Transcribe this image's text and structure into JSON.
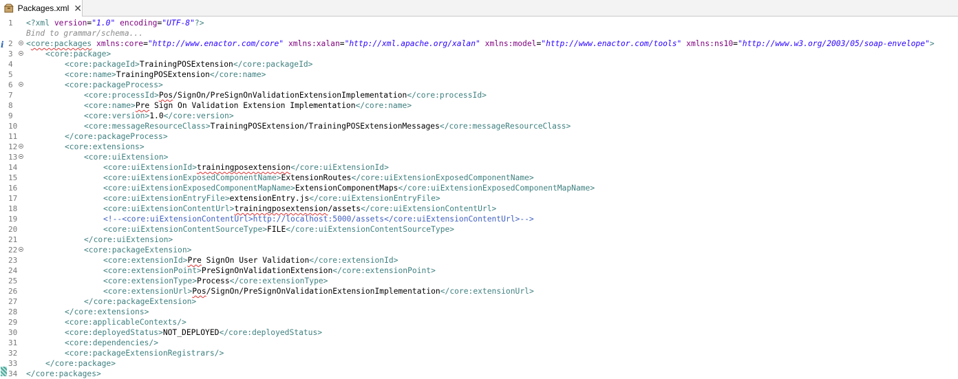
{
  "tab": {
    "title": "Packages.xml",
    "close": "✕"
  },
  "hint_text": "Bind to grammar/schema...",
  "lines": [
    {
      "n": "1",
      "fold": false,
      "indent": 0,
      "parts": [
        [
          "pi",
          "<?xml "
        ],
        [
          "attr",
          "version"
        ],
        [
          "t",
          "="
        ],
        [
          "str",
          "\"1.0\""
        ],
        [
          "t",
          " "
        ],
        [
          "attr",
          "encoding"
        ],
        [
          "t",
          "="
        ],
        [
          "str",
          "\"UTF-8\""
        ],
        [
          "pi",
          "?>"
        ]
      ]
    },
    {
      "n": "",
      "fold": false,
      "indent": 0,
      "hint": true,
      "parts": [
        [
          "hint",
          "Bind to grammar/schema..."
        ]
      ]
    },
    {
      "n": "2",
      "fold": true,
      "indent": 0,
      "parts": [
        [
          "tag",
          "<"
        ],
        [
          "tagsq",
          "core:packages"
        ],
        [
          "t",
          " "
        ],
        [
          "attr",
          "xmlns:core"
        ],
        [
          "t",
          "="
        ],
        [
          "str",
          "\"http://www.enactor.com/core\""
        ],
        [
          "t",
          " "
        ],
        [
          "attr",
          "xmlns:xalan"
        ],
        [
          "t",
          "="
        ],
        [
          "str",
          "\"http://xml.apache.org/xalan\""
        ],
        [
          "t",
          " "
        ],
        [
          "attr",
          "xmlns:model"
        ],
        [
          "t",
          "="
        ],
        [
          "str",
          "\"http://www.enactor.com/tools\""
        ],
        [
          "t",
          " "
        ],
        [
          "attr",
          "xmlns:ns10"
        ],
        [
          "t",
          "="
        ],
        [
          "str",
          "\"http://www.w3.org/2003/05/soap-envelope\""
        ],
        [
          "tag",
          ">"
        ]
      ]
    },
    {
      "n": "3",
      "fold": true,
      "indent": 1,
      "parts": [
        [
          "tag",
          "<core:package>"
        ]
      ]
    },
    {
      "n": "4",
      "fold": false,
      "indent": 2,
      "parts": [
        [
          "tag",
          "<core:packageId>"
        ],
        [
          "t",
          "TrainingPOSExtension"
        ],
        [
          "tag",
          "</core:packageId>"
        ]
      ]
    },
    {
      "n": "5",
      "fold": false,
      "indent": 2,
      "parts": [
        [
          "tag",
          "<core:name>"
        ],
        [
          "t",
          "TrainingPOSExtension"
        ],
        [
          "tag",
          "</core:name>"
        ]
      ]
    },
    {
      "n": "6",
      "fold": true,
      "indent": 2,
      "parts": [
        [
          "tag",
          "<core:packageProcess>"
        ]
      ]
    },
    {
      "n": "7",
      "fold": false,
      "indent": 3,
      "parts": [
        [
          "tag",
          "<core:processId>"
        ],
        [
          "sq",
          "Pos"
        ],
        [
          "t",
          "/SignOn/PreSignOnValidationExtensionImplementation"
        ],
        [
          "tag",
          "</core:processId>"
        ]
      ]
    },
    {
      "n": "8",
      "fold": false,
      "indent": 3,
      "parts": [
        [
          "tag",
          "<core:name>"
        ],
        [
          "sq",
          "Pre"
        ],
        [
          "t",
          " Sign On Validation Extension Implementation"
        ],
        [
          "tag",
          "</core:name>"
        ]
      ]
    },
    {
      "n": "9",
      "fold": false,
      "indent": 3,
      "parts": [
        [
          "tag",
          "<core:version>"
        ],
        [
          "t",
          "1.0"
        ],
        [
          "tag",
          "</core:version>"
        ]
      ]
    },
    {
      "n": "10",
      "fold": false,
      "indent": 3,
      "parts": [
        [
          "tag",
          "<core:messageResourceClass>"
        ],
        [
          "t",
          "TrainingPOSExtension/TrainingPOSExtensionMessages"
        ],
        [
          "tag",
          "</core:messageResourceClass>"
        ]
      ]
    },
    {
      "n": "11",
      "fold": false,
      "indent": 2,
      "parts": [
        [
          "tag",
          "</core:packageProcess>"
        ]
      ]
    },
    {
      "n": "12",
      "fold": true,
      "indent": 2,
      "parts": [
        [
          "tag",
          "<core:extensions>"
        ]
      ]
    },
    {
      "n": "13",
      "fold": true,
      "indent": 3,
      "parts": [
        [
          "tag",
          "<core:uiExtension>"
        ]
      ]
    },
    {
      "n": "14",
      "fold": false,
      "indent": 4,
      "parts": [
        [
          "tag",
          "<core:uiExtensionId>"
        ],
        [
          "sq",
          "trainingposextension"
        ],
        [
          "tag",
          "</core:uiExtensionId>"
        ]
      ]
    },
    {
      "n": "15",
      "fold": false,
      "indent": 4,
      "parts": [
        [
          "tag",
          "<core:uiExtensionExposedComponentName>"
        ],
        [
          "t",
          "ExtensionRoutes"
        ],
        [
          "tag",
          "</core:uiExtensionExposedComponentName>"
        ]
      ]
    },
    {
      "n": "16",
      "fold": false,
      "indent": 4,
      "parts": [
        [
          "tag",
          "<core:uiExtensionExposedComponentMapName>"
        ],
        [
          "t",
          "ExtensionComponentMaps"
        ],
        [
          "tag",
          "</core:uiExtensionExposedComponentMapName>"
        ]
      ]
    },
    {
      "n": "17",
      "fold": false,
      "indent": 4,
      "parts": [
        [
          "tag",
          "<core:uiExtensionEntryFile>"
        ],
        [
          "t",
          "extensionEntry.js"
        ],
        [
          "tag",
          "</core:uiExtensionEntryFile>"
        ]
      ]
    },
    {
      "n": "18",
      "fold": false,
      "indent": 4,
      "parts": [
        [
          "tag",
          "<core:uiExtensionContentUrl>"
        ],
        [
          "sq",
          "trainingposextension"
        ],
        [
          "t",
          "/assets"
        ],
        [
          "tag",
          "</core:uiExtensionContentUrl>"
        ]
      ]
    },
    {
      "n": "19",
      "fold": false,
      "indent": 4,
      "parts": [
        [
          "cmt",
          "<!--<core:uiExtensionContentUrl>http://localhost:5000/assets</core:uiExtensionContentUrl>-->"
        ]
      ]
    },
    {
      "n": "20",
      "fold": false,
      "indent": 4,
      "parts": [
        [
          "tag",
          "<core:uiExtensionContentSourceType>"
        ],
        [
          "t",
          "FILE"
        ],
        [
          "tag",
          "</core:uiExtensionContentSourceType>"
        ]
      ]
    },
    {
      "n": "21",
      "fold": false,
      "indent": 3,
      "parts": [
        [
          "tag",
          "</core:uiExtension>"
        ]
      ]
    },
    {
      "n": "22",
      "fold": true,
      "indent": 3,
      "parts": [
        [
          "tag",
          "<core:packageExtension>"
        ]
      ]
    },
    {
      "n": "23",
      "fold": false,
      "indent": 4,
      "parts": [
        [
          "tag",
          "<core:extensionId>"
        ],
        [
          "sq",
          "Pre"
        ],
        [
          "t",
          " SignOn User Validation"
        ],
        [
          "tag",
          "</core:extensionId>"
        ]
      ]
    },
    {
      "n": "24",
      "fold": false,
      "indent": 4,
      "parts": [
        [
          "tag",
          "<core:extensionPoint>"
        ],
        [
          "t",
          "PreSignOnValidationExtension"
        ],
        [
          "tag",
          "</core:extensionPoint>"
        ]
      ]
    },
    {
      "n": "25",
      "fold": false,
      "indent": 4,
      "parts": [
        [
          "tag",
          "<core:extensionType>"
        ],
        [
          "t",
          "Process"
        ],
        [
          "tag",
          "</core:extensionType>"
        ]
      ]
    },
    {
      "n": "26",
      "fold": false,
      "indent": 4,
      "parts": [
        [
          "tag",
          "<core:extensionUrl>"
        ],
        [
          "sq",
          "Pos"
        ],
        [
          "t",
          "/SignOn/PreSignOnValidationExtensionImplementation"
        ],
        [
          "tag",
          "</core:extensionUrl>"
        ]
      ]
    },
    {
      "n": "27",
      "fold": false,
      "indent": 3,
      "parts": [
        [
          "tag",
          "</core:packageExtension>"
        ]
      ]
    },
    {
      "n": "28",
      "fold": false,
      "indent": 2,
      "parts": [
        [
          "tag",
          "</core:extensions>"
        ]
      ]
    },
    {
      "n": "29",
      "fold": false,
      "indent": 2,
      "parts": [
        [
          "tag",
          "<core:applicableContexts/>"
        ]
      ]
    },
    {
      "n": "30",
      "fold": false,
      "indent": 2,
      "parts": [
        [
          "tag",
          "<core:deployedStatus>"
        ],
        [
          "t",
          "NOT_DEPLOYED"
        ],
        [
          "tag",
          "</core:deployedStatus>"
        ]
      ]
    },
    {
      "n": "31",
      "fold": false,
      "indent": 2,
      "parts": [
        [
          "tag",
          "<core:dependencies/>"
        ]
      ]
    },
    {
      "n": "32",
      "fold": false,
      "indent": 2,
      "parts": [
        [
          "tag",
          "<core:packageExtensionRegistrars/>"
        ]
      ]
    },
    {
      "n": "33",
      "fold": false,
      "indent": 1,
      "parts": [
        [
          "tag",
          "</core:package>"
        ]
      ]
    },
    {
      "n": "34",
      "fold": false,
      "indent": 0,
      "parts": [
        [
          "tag",
          "</core:packages>"
        ]
      ]
    }
  ],
  "colors": {
    "tag": "#3f7f7f",
    "attr": "#7f007f",
    "string": "#2a00ff",
    "comment": "#3f5fbf",
    "lineNumber": "#787878"
  }
}
